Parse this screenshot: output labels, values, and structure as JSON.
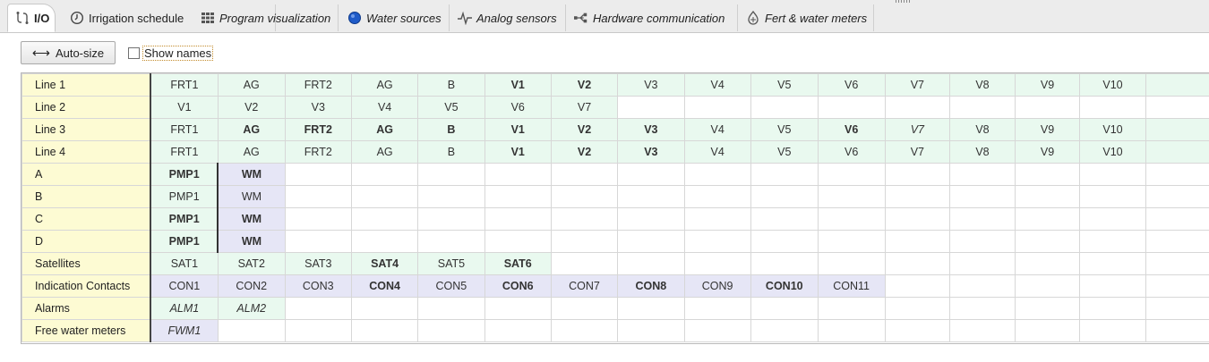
{
  "tabs": [
    {
      "label": "I/O",
      "icon": "io-icon",
      "active": true
    },
    {
      "label": "Irrigation schedule",
      "icon": "clock-icon",
      "active": false
    },
    {
      "label": "Program visualization",
      "icon": "grid-icon",
      "active": false
    },
    {
      "label": "Water sources",
      "icon": "circle-icon",
      "active": false
    },
    {
      "label": "Analog sensors",
      "icon": "pulse-icon",
      "active": false
    },
    {
      "label": "Hardware communication",
      "icon": "network-icon",
      "active": false
    },
    {
      "label": "Fert & water meters",
      "icon": "meter-icon",
      "active": false
    }
  ],
  "toolbar": {
    "autosize_label": "Auto-size",
    "show_names_label": "Show names",
    "show_names_checked": false
  },
  "grid": {
    "rows": [
      {
        "label": "Line 1",
        "cells": [
          {
            "t": "FRT1",
            "bg": "g"
          },
          {
            "t": "AG",
            "bg": "g"
          },
          {
            "t": "FRT2",
            "bg": "g"
          },
          {
            "t": "AG",
            "bg": "g"
          },
          {
            "t": "B",
            "bg": "g"
          },
          {
            "t": "V1",
            "bg": "g",
            "s": "b"
          },
          {
            "t": "V2",
            "bg": "g",
            "s": "b"
          },
          {
            "t": "V3",
            "bg": "g"
          },
          {
            "t": "V4",
            "bg": "g"
          },
          {
            "t": "V5",
            "bg": "g"
          },
          {
            "t": "V6",
            "bg": "g"
          },
          {
            "t": "V7",
            "bg": "g"
          },
          {
            "t": "V8",
            "bg": "g"
          },
          {
            "t": "V9",
            "bg": "g"
          },
          {
            "t": "V10",
            "bg": "g"
          },
          {
            "t": "",
            "bg": "g"
          }
        ]
      },
      {
        "label": "Line 2",
        "cells": [
          {
            "t": "V1",
            "bg": "g"
          },
          {
            "t": "V2",
            "bg": "g"
          },
          {
            "t": "V3",
            "bg": "g"
          },
          {
            "t": "V4",
            "bg": "g"
          },
          {
            "t": "V5",
            "bg": "g"
          },
          {
            "t": "V6",
            "bg": "g"
          },
          {
            "t": "V7",
            "bg": "g"
          },
          {
            "t": "",
            "bg": "w"
          },
          {
            "t": "",
            "bg": "w"
          },
          {
            "t": "",
            "bg": "w"
          },
          {
            "t": "",
            "bg": "w"
          },
          {
            "t": "",
            "bg": "w"
          },
          {
            "t": "",
            "bg": "w"
          },
          {
            "t": "",
            "bg": "w"
          },
          {
            "t": "",
            "bg": "w"
          },
          {
            "t": "",
            "bg": "w"
          }
        ]
      },
      {
        "label": "Line 3",
        "cells": [
          {
            "t": "FRT1",
            "bg": "g"
          },
          {
            "t": "AG",
            "bg": "g",
            "s": "blue"
          },
          {
            "t": "FRT2",
            "bg": "g",
            "s": "b"
          },
          {
            "t": "AG",
            "bg": "g",
            "s": "b"
          },
          {
            "t": "B",
            "bg": "g",
            "s": "b"
          },
          {
            "t": "V1",
            "bg": "g",
            "s": "b"
          },
          {
            "t": "V2",
            "bg": "g",
            "s": "b"
          },
          {
            "t": "V3",
            "bg": "g",
            "s": "b"
          },
          {
            "t": "V4",
            "bg": "g"
          },
          {
            "t": "V5",
            "bg": "g"
          },
          {
            "t": "V6",
            "bg": "g",
            "s": "red"
          },
          {
            "t": "V7",
            "bg": "g",
            "s": "it"
          },
          {
            "t": "V8",
            "bg": "g"
          },
          {
            "t": "V9",
            "bg": "g"
          },
          {
            "t": "V10",
            "bg": "g"
          },
          {
            "t": "",
            "bg": "g"
          }
        ]
      },
      {
        "label": "Line 4",
        "cells": [
          {
            "t": "FRT1",
            "bg": "g"
          },
          {
            "t": "AG",
            "bg": "g"
          },
          {
            "t": "FRT2",
            "bg": "g"
          },
          {
            "t": "AG",
            "bg": "g"
          },
          {
            "t": "B",
            "bg": "g"
          },
          {
            "t": "V1",
            "bg": "g",
            "s": "b"
          },
          {
            "t": "V2",
            "bg": "g",
            "s": "b"
          },
          {
            "t": "V3",
            "bg": "g",
            "s": "b"
          },
          {
            "t": "V4",
            "bg": "g"
          },
          {
            "t": "V5",
            "bg": "g"
          },
          {
            "t": "V6",
            "bg": "g"
          },
          {
            "t": "V7",
            "bg": "g"
          },
          {
            "t": "V8",
            "bg": "g"
          },
          {
            "t": "V9",
            "bg": "g"
          },
          {
            "t": "V10",
            "bg": "g"
          },
          {
            "t": "",
            "bg": "g"
          }
        ]
      },
      {
        "label": "A",
        "cells": [
          {
            "t": "PMP1",
            "bg": "g",
            "s": "b"
          },
          {
            "t": "WM",
            "bg": "p",
            "s": "b",
            "div": true
          }
        ]
      },
      {
        "label": "B",
        "cells": [
          {
            "t": "PMP1",
            "bg": "g"
          },
          {
            "t": "WM",
            "bg": "p",
            "div": true
          }
        ]
      },
      {
        "label": "C",
        "cells": [
          {
            "t": "PMP1",
            "bg": "g",
            "s": "b"
          },
          {
            "t": "WM",
            "bg": "p",
            "s": "b",
            "div": true
          }
        ]
      },
      {
        "label": "D",
        "cells": [
          {
            "t": "PMP1",
            "bg": "g",
            "s": "b"
          },
          {
            "t": "WM",
            "bg": "p",
            "s": "b",
            "div": true
          }
        ]
      },
      {
        "label": "Satellites",
        "cells": [
          {
            "t": "SAT1",
            "bg": "g"
          },
          {
            "t": "SAT2",
            "bg": "g"
          },
          {
            "t": "SAT3",
            "bg": "g"
          },
          {
            "t": "SAT4",
            "bg": "g",
            "s": "b"
          },
          {
            "t": "SAT5",
            "bg": "g"
          },
          {
            "t": "SAT6",
            "bg": "g",
            "s": "b"
          }
        ]
      },
      {
        "label": "Indication Contacts",
        "cells": [
          {
            "t": "CON1",
            "bg": "p"
          },
          {
            "t": "CON2",
            "bg": "p"
          },
          {
            "t": "CON3",
            "bg": "p"
          },
          {
            "t": "CON4",
            "bg": "p",
            "s": "b"
          },
          {
            "t": "CON5",
            "bg": "p"
          },
          {
            "t": "CON6",
            "bg": "p",
            "s": "b"
          },
          {
            "t": "CON7",
            "bg": "p"
          },
          {
            "t": "CON8",
            "bg": "p",
            "s": "b"
          },
          {
            "t": "CON9",
            "bg": "p"
          },
          {
            "t": "CON10",
            "bg": "p",
            "s": "b"
          },
          {
            "t": "CON11",
            "bg": "p"
          }
        ]
      },
      {
        "label": "Alarms",
        "cells": [
          {
            "t": "ALM1",
            "bg": "g",
            "s": "it"
          },
          {
            "t": "ALM2",
            "bg": "g",
            "s": "it"
          }
        ]
      },
      {
        "label": "Free water meters",
        "cells": [
          {
            "t": "FWM1",
            "bg": "p",
            "s": "it"
          }
        ]
      }
    ],
    "total_columns": 16
  }
}
